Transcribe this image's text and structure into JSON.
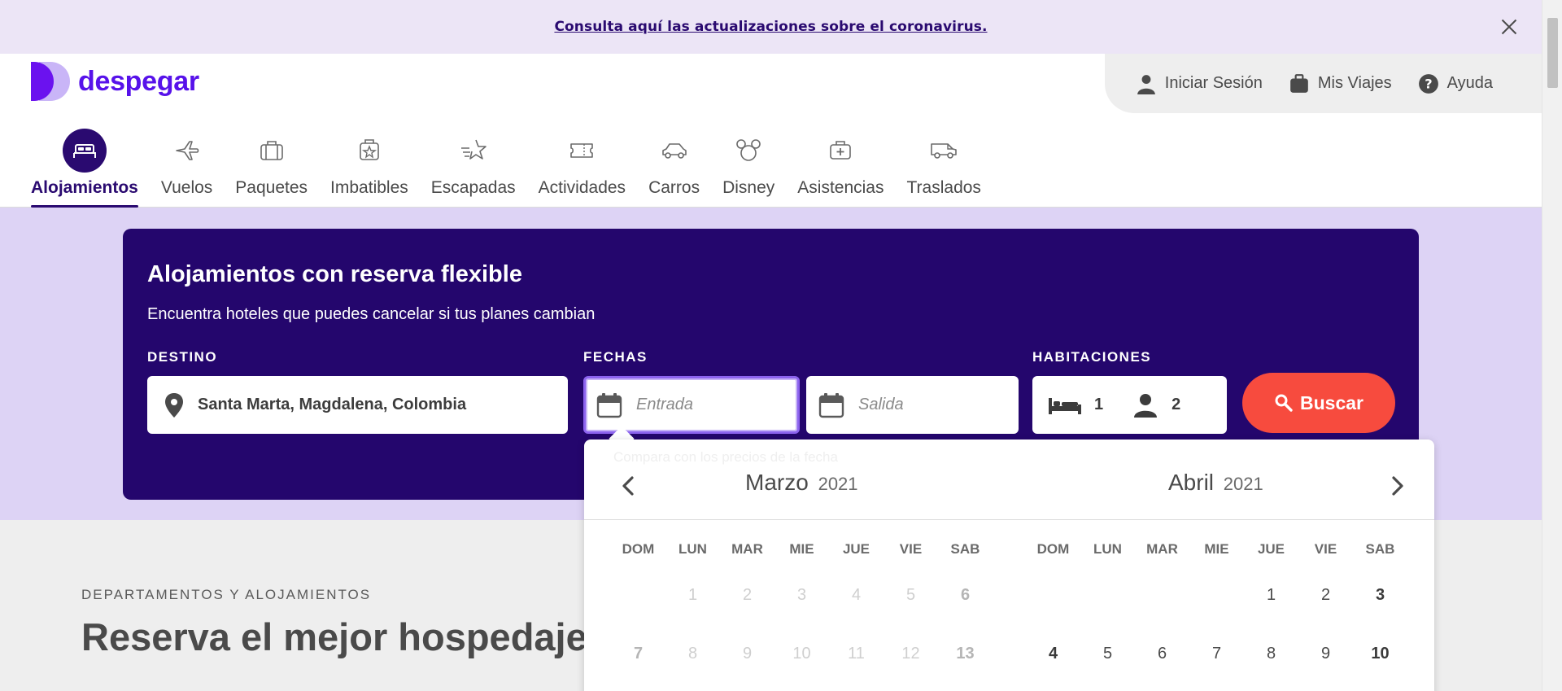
{
  "banner": {
    "link_text": "Consulta aquí las actualizaciones sobre el coronavirus.",
    "close_icon": "close-icon"
  },
  "brand": {
    "name": "despegar",
    "primary_color": "#5712ea",
    "dark_color": "#24066d",
    "cta_color": "#f74b3e"
  },
  "user_menu": [
    {
      "label": "Iniciar Sesión",
      "icon": "user-icon"
    },
    {
      "label": "Mis Viajes",
      "icon": "suitcase-icon"
    },
    {
      "label": "Ayuda",
      "icon": "help-icon"
    }
  ],
  "nav": {
    "active": "Alojamientos",
    "items": [
      {
        "label": "Alojamientos",
        "icon": "bed-icon"
      },
      {
        "label": "Vuelos",
        "icon": "plane-icon"
      },
      {
        "label": "Paquetes",
        "icon": "package-icon"
      },
      {
        "label": "Imbatibles",
        "icon": "deal-icon"
      },
      {
        "label": "Escapadas",
        "icon": "star-icon"
      },
      {
        "label": "Actividades",
        "icon": "ticket-icon"
      },
      {
        "label": "Carros",
        "icon": "car-icon"
      },
      {
        "label": "Disney",
        "icon": "mickey-icon"
      },
      {
        "label": "Asistencias",
        "icon": "medkit-icon"
      },
      {
        "label": "Traslados",
        "icon": "van-icon"
      }
    ]
  },
  "search": {
    "title": "Alojamientos con reserva flexible",
    "subtitle": "Encuentra hoteles que puedes cancelar si tus planes cambian",
    "destination_label": "DESTINO",
    "destination_value": "Santa Marta, Magdalena, Colombia",
    "dates_label": "FECHAS",
    "checkin_placeholder": "Entrada",
    "checkout_placeholder": "Salida",
    "rooms_label": "HABITACIONES",
    "rooms_value": "1",
    "guests_value": "2",
    "button_label": "Buscar"
  },
  "calendar": {
    "hint": "Compara con los precios de la fecha",
    "months": [
      {
        "name": "Marzo",
        "year": "2021",
        "weekdays": [
          "DOM",
          "LUN",
          "MAR",
          "MIE",
          "JUE",
          "VIE",
          "SAB"
        ],
        "rows": [
          [
            "",
            "1",
            "2",
            "3",
            "4",
            "5",
            "6"
          ],
          [
            "7",
            "8",
            "9",
            "10",
            "11",
            "12",
            "13"
          ]
        ],
        "disabled": true
      },
      {
        "name": "Abril",
        "year": "2021",
        "weekdays": [
          "DOM",
          "LUN",
          "MAR",
          "MIE",
          "JUE",
          "VIE",
          "SAB"
        ],
        "rows": [
          [
            "",
            "",
            "",
            "",
            "1",
            "2",
            "3"
          ],
          [
            "4",
            "5",
            "6",
            "7",
            "8",
            "9",
            "10"
          ]
        ],
        "disabled": false
      }
    ]
  },
  "section": {
    "kicker": "DEPARTAMENTOS Y ALOJAMIENTOS",
    "title": "Reserva el mejor hospedaje para tu viaje"
  }
}
